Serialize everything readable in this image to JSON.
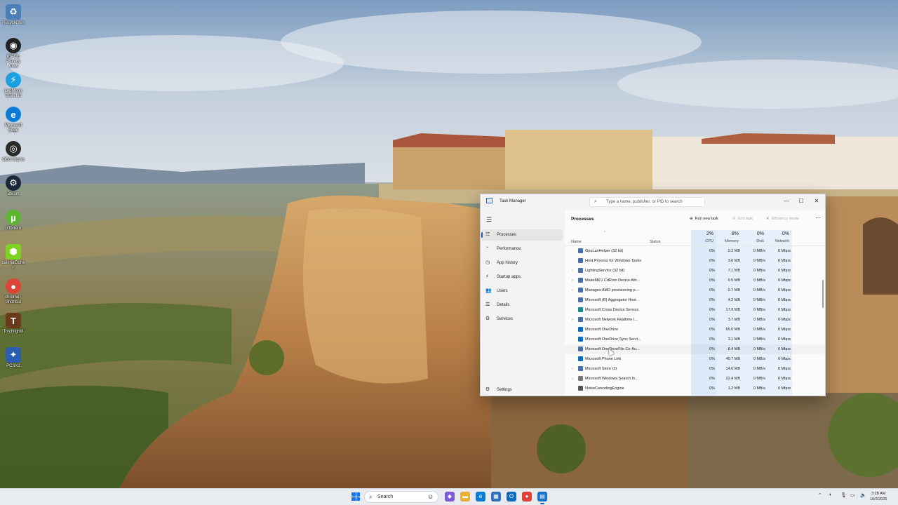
{
  "desktop": {
    "icons": [
      {
        "label": "Recycle Bin",
        "icon": "recycle-bin-icon",
        "color": "#4a7fb8"
      },
      {
        "label": "iRACE Privacy View",
        "icon": "privacy-view-icon",
        "color": "#222222"
      },
      {
        "label": "LeoMoon Tools.bin",
        "icon": "lightning-icon",
        "color": "#1aa0e0"
      },
      {
        "label": "Microsoft Edge",
        "icon": "edge-icon",
        "color": "#0c7dd6"
      },
      {
        "label": "OBS Studio",
        "icon": "obs-icon",
        "color": "#2b2b2b"
      },
      {
        "label": "Steam",
        "icon": "steam-icon",
        "color": "#1b2838"
      },
      {
        "label": "µTorrent",
        "icon": "utorrent-icon",
        "color": "#5cb531"
      },
      {
        "label": "balenaEtcher",
        "icon": "etcher-icon",
        "color": "#7ed321"
      },
      {
        "label": "chrome - Shortcut",
        "icon": "chrome-icon",
        "color": "#db4437"
      },
      {
        "label": "TorchlightII",
        "icon": "torchlight-icon",
        "color": "#6b3a1a"
      },
      {
        "label": "PCSX2",
        "icon": "pcsx2-icon",
        "color": "#2a5fb0"
      }
    ]
  },
  "window": {
    "title": "Task Manager",
    "search_placeholder": "Type a name, publisher, or PID to search",
    "controls": {
      "minimize": "—",
      "maximize": "☐",
      "close": "✕"
    }
  },
  "sidebar": {
    "items": [
      {
        "label": "Processes",
        "icon": "processes-icon",
        "glyph": "☷",
        "active": true
      },
      {
        "label": "Performance",
        "icon": "performance-icon",
        "glyph": "◔",
        "active": false
      },
      {
        "label": "App history",
        "icon": "app-history-icon",
        "glyph": "◷",
        "active": false
      },
      {
        "label": "Startup apps",
        "icon": "startup-icon",
        "glyph": "⚡",
        "active": false
      },
      {
        "label": "Users",
        "icon": "users-icon",
        "glyph": "👥",
        "active": false
      },
      {
        "label": "Details",
        "icon": "details-icon",
        "glyph": "☰",
        "active": false
      },
      {
        "label": "Services",
        "icon": "services-icon",
        "glyph": "⚙",
        "active": false
      }
    ],
    "settings_label": "Settings"
  },
  "toolbar": {
    "title": "Processes",
    "run_new_task": "Run new task",
    "end_task": "End task",
    "efficiency_mode": "Efficiency mode"
  },
  "columns": {
    "name": "Name",
    "status": "Status",
    "cpu": {
      "label": "CPU",
      "pct": "2%"
    },
    "memory": {
      "label": "Memory",
      "pct": "8%"
    },
    "disk": {
      "label": "Disk",
      "pct": "0%"
    },
    "network": {
      "label": "Network",
      "pct": "0%"
    }
  },
  "processes": [
    {
      "name": "GpuLanHelper (32 bit)",
      "expandable": false,
      "cpu": "0%",
      "memory": "0.2 MB",
      "disk": "0 MB/s",
      "network": "0 Mbps",
      "icon_color": "#4a6fa5"
    },
    {
      "name": "Host Process for Windows Tasks",
      "expandable": false,
      "cpu": "0%",
      "memory": "3.6 MB",
      "disk": "0 MB/s",
      "network": "0 Mbps",
      "icon_color": "#4a6fa5"
    },
    {
      "name": "LightingService (32 bit)",
      "expandable": true,
      "cpu": "0%",
      "memory": "7.1 MB",
      "disk": "0 MB/s",
      "network": "0 Mbps",
      "icon_color": "#4a6fa5"
    },
    {
      "name": "MakeMKV CdRom Device Attr...",
      "expandable": true,
      "cpu": "0%",
      "memory": "0.5 MB",
      "disk": "0 MB/s",
      "network": "0 Mbps",
      "icon_color": "#4a6fa5"
    },
    {
      "name": "Manages AMD provisioning p...",
      "expandable": true,
      "cpu": "0%",
      "memory": "0.7 MB",
      "disk": "0 MB/s",
      "network": "0 Mbps",
      "icon_color": "#4a6fa5"
    },
    {
      "name": "Microsoft (R) Aggregator Host",
      "expandable": false,
      "cpu": "0%",
      "memory": "4.2 MB",
      "disk": "0 MB/s",
      "network": "0 Mbps",
      "icon_color": "#4a6fa5"
    },
    {
      "name": "Microsoft Cross Device Service",
      "expandable": false,
      "cpu": "0%",
      "memory": "17.9 MB",
      "disk": "0 MB/s",
      "network": "0 Mbps",
      "icon_color": "#1a8a8a"
    },
    {
      "name": "Microsoft Network Realtime I...",
      "expandable": true,
      "cpu": "0%",
      "memory": "3.7 MB",
      "disk": "0 MB/s",
      "network": "0 Mbps",
      "icon_color": "#4a6fa5"
    },
    {
      "name": "Microsoft OneDrive",
      "expandable": false,
      "cpu": "0%",
      "memory": "66.0 MB",
      "disk": "0 MB/s",
      "network": "0 Mbps",
      "icon_color": "#0f6cbd"
    },
    {
      "name": "Microsoft OneDrive Sync Servi...",
      "expandable": false,
      "cpu": "0%",
      "memory": "3.1 MB",
      "disk": "0 MB/s",
      "network": "0 Mbps",
      "icon_color": "#0f6cbd"
    },
    {
      "name": "Microsoft OneDriveFile Co-Au...",
      "expandable": false,
      "cpu": "0%",
      "memory": "8.4 MB",
      "disk": "0 MB/s",
      "network": "0 Mbps",
      "icon_color": "#4a6fa5"
    },
    {
      "name": "Microsoft Phone Link",
      "expandable": false,
      "cpu": "0%",
      "memory": "40.7 MB",
      "disk": "0 MB/s",
      "network": "0 Mbps",
      "icon_color": "#0f6cbd"
    },
    {
      "name": "Microsoft Store (2)",
      "expandable": true,
      "cpu": "0%",
      "memory": "14.6 MB",
      "disk": "0 MB/s",
      "network": "0 Mbps",
      "icon_color": "#4a6fa5"
    },
    {
      "name": "Microsoft Windows Search In...",
      "expandable": true,
      "cpu": "0%",
      "memory": "22.4 MB",
      "disk": "0 MB/s",
      "network": "0 Mbps",
      "icon_color": "#777777"
    },
    {
      "name": "NoiseCancelingEngine",
      "expandable": false,
      "cpu": "0%",
      "memory": "1.2 MB",
      "disk": "0 MB/s",
      "network": "0 Mbps",
      "icon_color": "#555555"
    }
  ],
  "taskbar": {
    "search_label": "Search",
    "apps": [
      {
        "name": "copilot-icon",
        "color": "#7b5cd6",
        "glyph": "◆"
      },
      {
        "name": "file-explorer-icon",
        "color": "#e8b23a",
        "glyph": "▬"
      },
      {
        "name": "edge-icon",
        "color": "#0c7dd6",
        "glyph": "e"
      },
      {
        "name": "store-icon",
        "color": "#2f6fb7",
        "glyph": "▦"
      },
      {
        "name": "outlook-icon",
        "color": "#0f6cbd",
        "glyph": "O"
      },
      {
        "name": "chrome-icon",
        "color": "#db4437",
        "glyph": "●"
      },
      {
        "name": "task-manager-icon",
        "color": "#1a73c8",
        "glyph": "▤"
      }
    ],
    "time": "3:28 AM",
    "date": "10/3/2025"
  }
}
